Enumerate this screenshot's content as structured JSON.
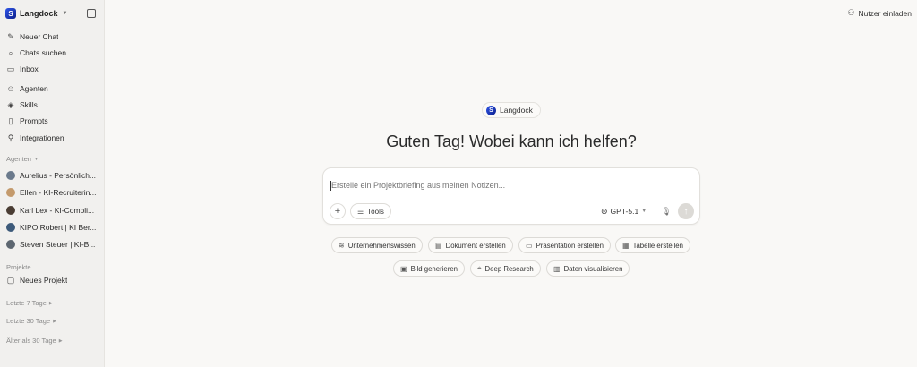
{
  "brand": {
    "name": "Langdock"
  },
  "sidebar": {
    "nav": [
      {
        "label": "Neuer Chat",
        "icon": "edit-icon"
      },
      {
        "label": "Chats suchen",
        "icon": "search-icon"
      },
      {
        "label": "Inbox",
        "icon": "inbox-icon"
      }
    ],
    "tools": [
      {
        "label": "Agenten",
        "icon": "agents-icon"
      },
      {
        "label": "Skills",
        "icon": "layers-icon"
      },
      {
        "label": "Prompts",
        "icon": "book-icon"
      },
      {
        "label": "Integrationen",
        "icon": "plug-icon"
      }
    ],
    "agents_section": "Agenten",
    "agents": [
      {
        "label": "Aurelius - Persönlich...",
        "color": "#6b7a8c"
      },
      {
        "label": "Ellen - KI-Recruiterin...",
        "color": "#c49a6c"
      },
      {
        "label": "Karl Lex - KI-Compli...",
        "color": "#4a3d34"
      },
      {
        "label": "KIPO Robert | KI Ber...",
        "color": "#3d5a7a"
      },
      {
        "label": "Steven Steuer | KI-B...",
        "color": "#5d6670"
      }
    ],
    "projects_section": "Projekte",
    "new_project": "Neues Projekt",
    "history": [
      "Letzte 7 Tage",
      "Letzte 30 Tage",
      "Älter als 30 Tage"
    ]
  },
  "header": {
    "invite": "Nutzer einladen"
  },
  "main": {
    "pill": "Langdock",
    "headline": "Guten Tag! Wobei kann ich helfen?",
    "placeholder": "Erstelle ein Projektbriefing aus meinen Notizen...",
    "tools": "Tools",
    "model": "GPT-5.1",
    "chips_row1": [
      "Unternehmenswissen",
      "Dokument erstellen",
      "Präsentation erstellen",
      "Tabelle erstellen"
    ],
    "chips_row2": [
      "Bild generieren",
      "Deep Research",
      "Daten visualisieren"
    ]
  },
  "colors": {
    "accent": "#2f56e8",
    "sidebar_bg": "#f1f0ee",
    "main_bg": "#f9f8f6"
  }
}
